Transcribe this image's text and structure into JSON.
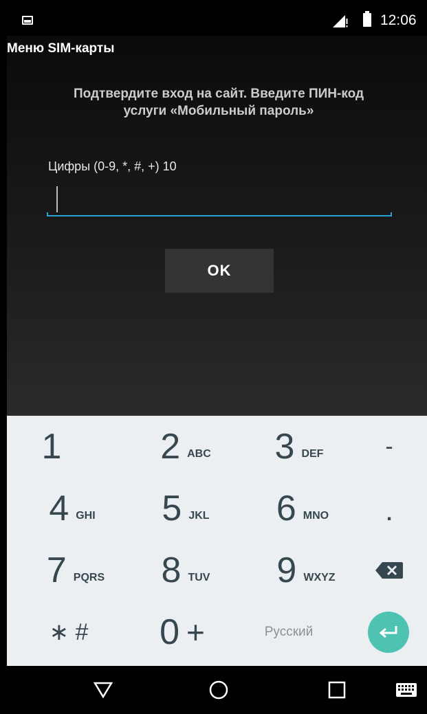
{
  "status_bar": {
    "time": "12:06",
    "icons": [
      "gallery-icon",
      "signal-icon",
      "battery-icon"
    ]
  },
  "app": {
    "title": "Меню SIM-карты",
    "prompt_line1": "Подтвердите вход на сайт. Введите ПИН-код",
    "prompt_line2": "услуги «Мобильный пароль»",
    "field_label": "Цифры (0-9, *, #, +) 10",
    "input_value": "",
    "ok_label": "OK"
  },
  "keyboard": {
    "keys": [
      {
        "digit": "1",
        "letters": ""
      },
      {
        "digit": "2",
        "letters": "ABC"
      },
      {
        "digit": "3",
        "letters": "DEF"
      },
      {
        "digit": "4",
        "letters": "GHI"
      },
      {
        "digit": "5",
        "letters": "JKL"
      },
      {
        "digit": "6",
        "letters": "MNO"
      },
      {
        "digit": "7",
        "letters": "PQRS"
      },
      {
        "digit": "8",
        "letters": "TUV"
      },
      {
        "digit": "9",
        "letters": "WXYZ"
      },
      {
        "digit": "0",
        "letters": "+"
      }
    ],
    "minus": "-",
    "dot": ".",
    "star_hash": "∗ #",
    "language": "Русский",
    "colors": {
      "background": "#eceff1",
      "enter": "#4ec3b2",
      "key_text": "#37474f"
    }
  },
  "nav_bar": {
    "icons": [
      "back-icon",
      "home-icon",
      "recents-icon",
      "keyboard-icon"
    ]
  }
}
